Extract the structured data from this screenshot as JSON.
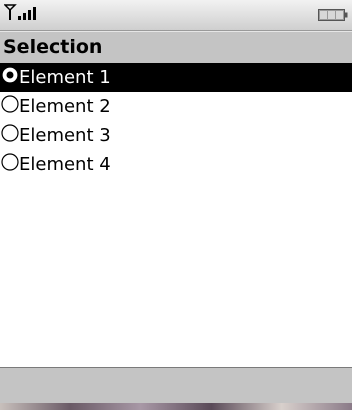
{
  "status": {
    "signal_icon": "signal-strength-icon",
    "battery_icon": "battery-icon"
  },
  "title": "Selection",
  "list": {
    "items": [
      {
        "label": "Element 1",
        "selected": true
      },
      {
        "label": "Element 2",
        "selected": false
      },
      {
        "label": "Element 3",
        "selected": false
      },
      {
        "label": "Element 4",
        "selected": false
      }
    ]
  },
  "colors": {
    "bar_gray": "#c4c4c4",
    "highlight": "#000000",
    "highlight_text": "#ffffff"
  }
}
